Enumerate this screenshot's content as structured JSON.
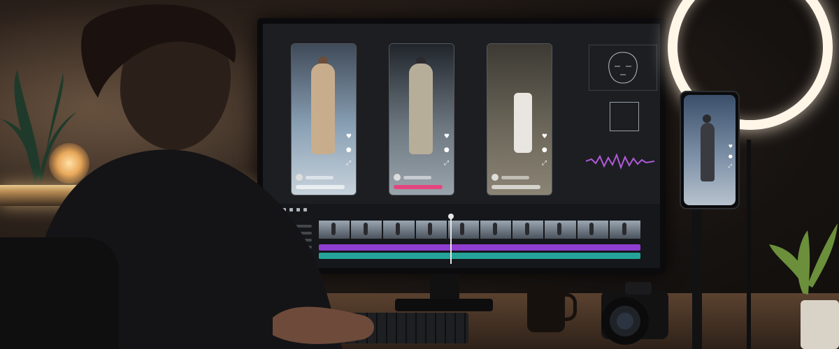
{
  "scene": {
    "colors": {
      "accent_purple": "#8f3ed0",
      "accent_teal": "#25a39a",
      "ring_light": "#fff6e8"
    }
  },
  "editor": {
    "cards": [
      {
        "name": "video-card-1",
        "theme": "fashion"
      },
      {
        "name": "video-card-2",
        "theme": "dance"
      },
      {
        "name": "video-card-3",
        "theme": "product"
      }
    ],
    "icons": {
      "heart": "♥",
      "comment": "●",
      "share": "⤢",
      "expand": "⤡"
    }
  },
  "phone": {
    "icons": {
      "heart": "♥",
      "comment": "●",
      "share": "⤢"
    }
  }
}
